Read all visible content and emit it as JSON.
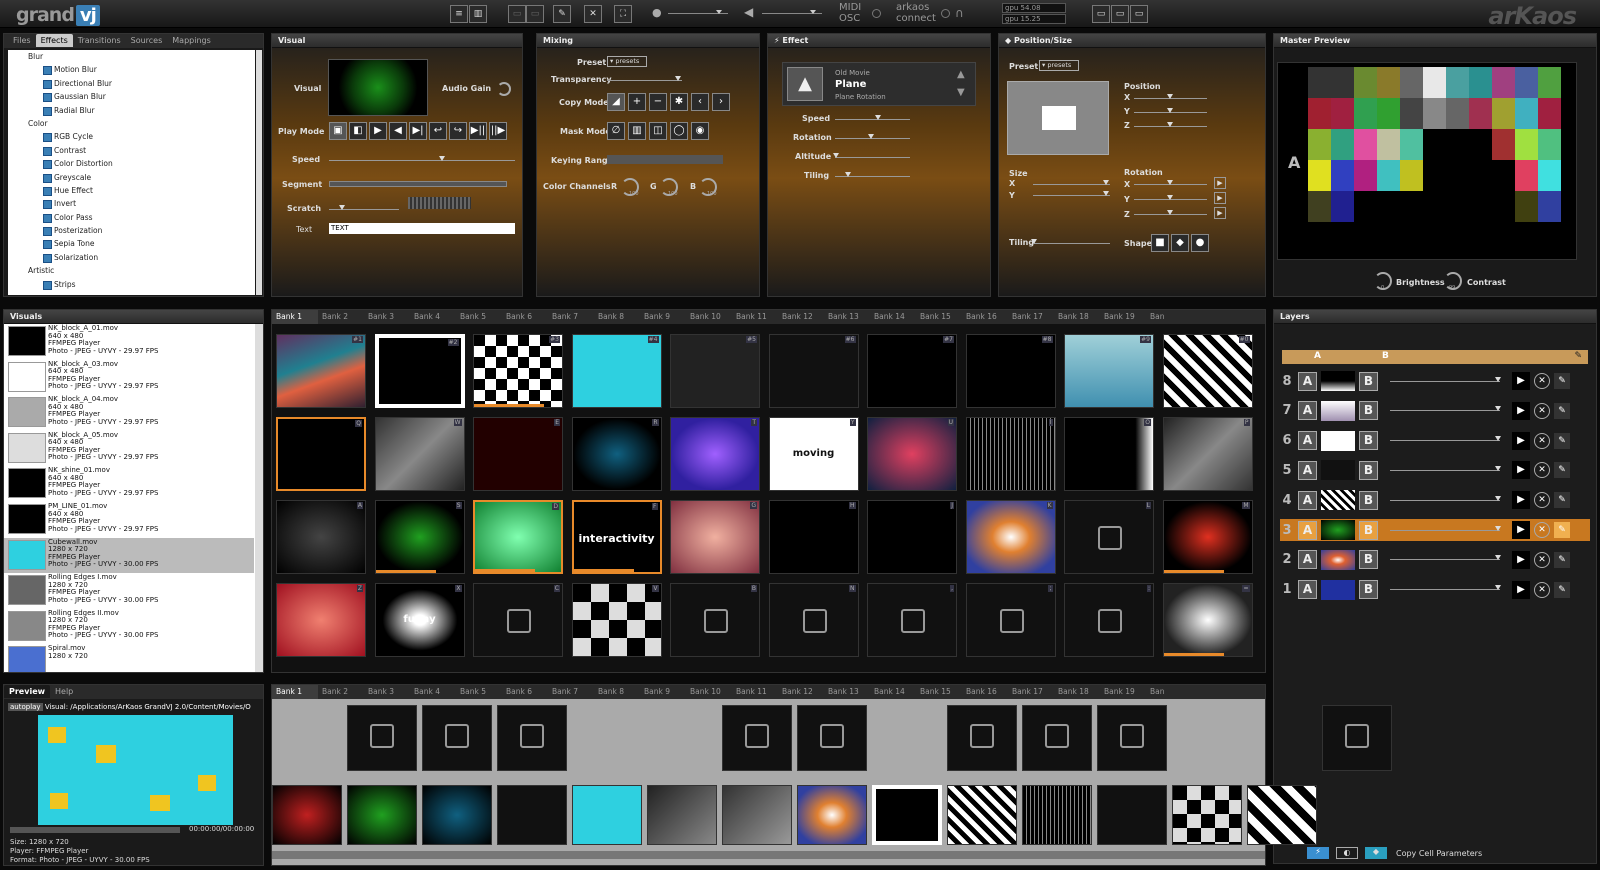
{
  "app": {
    "logo_text": "grand",
    "logo_badge": "vj",
    "brand": "arKaos",
    "midi": "MIDI",
    "osc": "OSC",
    "connect1": "arkaos",
    "connect2": "connect",
    "gpu1": "gpu 54.08",
    "gpu2": "gpu 15.25"
  },
  "left_tabs": [
    "Files",
    "Effects",
    "Transitions",
    "Sources",
    "Mappings"
  ],
  "effects_tree": [
    {
      "t": "cat",
      "l": "Blur"
    },
    {
      "t": "it",
      "l": "Motion Blur"
    },
    {
      "t": "it",
      "l": "Directional Blur"
    },
    {
      "t": "it",
      "l": "Gaussian Blur"
    },
    {
      "t": "it",
      "l": "Radial Blur"
    },
    {
      "t": "cat",
      "l": "Color"
    },
    {
      "t": "it",
      "l": "RGB Cycle"
    },
    {
      "t": "it",
      "l": "Contrast"
    },
    {
      "t": "it",
      "l": "Color Distortion"
    },
    {
      "t": "it",
      "l": "Greyscale"
    },
    {
      "t": "it",
      "l": "Hue Effect"
    },
    {
      "t": "it",
      "l": "Invert"
    },
    {
      "t": "it",
      "l": "Color Pass"
    },
    {
      "t": "it",
      "l": "Posterization"
    },
    {
      "t": "it",
      "l": "Sepia Tone"
    },
    {
      "t": "it",
      "l": "Solarization"
    },
    {
      "t": "cat",
      "l": "Artistic"
    },
    {
      "t": "it",
      "l": "Strips"
    }
  ],
  "visual_panel": {
    "title": "Visual",
    "visual_label": "Visual",
    "audio_gain": "Audio Gain",
    "play_mode": "Play Mode",
    "speed": "Speed",
    "segment": "Segment",
    "scratch": "Scratch",
    "text_label": "Text",
    "text_value": "TEXT"
  },
  "mixing_panel": {
    "title": "Mixing",
    "preset": "Preset",
    "presets": "presets",
    "transparency": "Transparency",
    "copy_mode": "Copy Mode",
    "mask_mode": "Mask Mode",
    "keying_range": "Keying Range",
    "color_channels": "Color Channels",
    "r": "R",
    "g": "G",
    "b": "B",
    "r_val": "100",
    "g_val": "100",
    "b_val": "100"
  },
  "effect_panel": {
    "title": "Effect",
    "group": "Old Movie",
    "name": "Plane",
    "sub": "Plane Rotation",
    "speed": "Speed",
    "rotation": "Rotation",
    "altitude": "Altitude",
    "tiling": "Tiling"
  },
  "position_panel": {
    "title": "Position/Size",
    "preset": "Preset",
    "presets": "presets",
    "position": "Position",
    "x": "X",
    "y": "Y",
    "z": "Z",
    "size": "Size",
    "rotation": "Rotation",
    "tiling": "Tiling",
    "shape": "Shape"
  },
  "master": {
    "title": "Master Preview",
    "layer": "A",
    "brightness": "Brightness",
    "contrast": "Contrast",
    "b_val": "0",
    "c_val": "99"
  },
  "visuals_header": "Visuals",
  "visuals": [
    {
      "name": "NK_block_A_01.mov",
      "size": "640 x 480",
      "player": "FFMPEG Player",
      "format": "Photo - JPEG - UYVY - 29.97 FPS"
    },
    {
      "name": "NK_block_A_03.mov",
      "size": "640 x 480",
      "player": "FFMPEG Player",
      "format": "Photo - JPEG - UYVY - 29.97 FPS"
    },
    {
      "name": "NK_block_A_04.mov",
      "size": "640 x 480",
      "player": "FFMPEG Player",
      "format": "Photo - JPEG - UYVY - 29.97 FPS"
    },
    {
      "name": "NK_block_A_05.mov",
      "size": "640 x 480",
      "player": "FFMPEG Player",
      "format": "Photo - JPEG - UYVY - 29.97 FPS"
    },
    {
      "name": "NK_shine_01.mov",
      "size": "640 x 480",
      "player": "FFMPEG Player",
      "format": "Photo - JPEG - UYVY - 29.97 FPS"
    },
    {
      "name": "PM_LINE_01.mov",
      "size": "640 x 480",
      "player": "FFMPEG Player",
      "format": "Photo - JPEG - UYVY - 29.97 FPS"
    },
    {
      "name": "Cubewall.mov",
      "size": "1280 x 720",
      "player": "FFMPEG Player",
      "format": "Photo - JPEG - UYVY - 30.00 FPS"
    },
    {
      "name": "Rolling Edges I.mov",
      "size": "1280 x 720",
      "player": "FFMPEG Player",
      "format": "Photo - JPEG - UYVY - 30.00 FPS"
    },
    {
      "name": "Rolling Edges II.mov",
      "size": "1280 x 720",
      "player": "FFMPEG Player",
      "format": "Photo - JPEG - UYVY - 30.00 FPS"
    },
    {
      "name": "Spiral.mov",
      "size": "1280 x 720",
      "player": "",
      "format": ""
    }
  ],
  "preview": {
    "tab1": "Preview",
    "tab2": "Help",
    "autoplay": "autoplay",
    "path": "Visual: /Applications/ArKaos GrandVJ 2.0/Content/Movies/O",
    "time": "00:00:00/00:00:00",
    "size": "Size: 1280 x 720",
    "player": "Player: FFMPEG Player",
    "format": "Format: Photo - JPEG - UYVY - 30.00 FPS"
  },
  "banks": [
    "Bank 1",
    "Bank 2",
    "Bank 3",
    "Bank 4",
    "Bank 5",
    "Bank 6",
    "Bank 7",
    "Bank 8",
    "Bank 9",
    "Bank 10",
    "Bank 11",
    "Bank 12",
    "Bank 13",
    "Bank 14",
    "Bank 15",
    "Bank 16",
    "Bank 17",
    "Bank 18",
    "Bank 19",
    "Ban"
  ],
  "grid_keys": [
    [
      "#1",
      "#2",
      "#3",
      "#4",
      "#5",
      "#6",
      "#7",
      "#8",
      "#9",
      "#0"
    ],
    [
      "Q",
      "W",
      "E",
      "R",
      "T",
      "Y",
      "U",
      "I",
      "O",
      "P"
    ],
    [
      "A",
      "S",
      "D",
      "F",
      "G",
      "H",
      "J",
      "K",
      "L",
      "M"
    ],
    [
      "Z",
      "X",
      "C",
      "V",
      "B",
      "N",
      ",",
      ";",
      ":",
      "="
    ]
  ],
  "cell_texts": {
    "moving": "moving",
    "interactivity": "interactivity",
    "funny": "funny"
  },
  "layers": {
    "title": "Layers",
    "a": "A",
    "b": "B",
    "rows": [
      "8",
      "7",
      "6",
      "5",
      "4",
      "3",
      "2",
      "1"
    ],
    "copy": "Copy Cell Parameters"
  }
}
